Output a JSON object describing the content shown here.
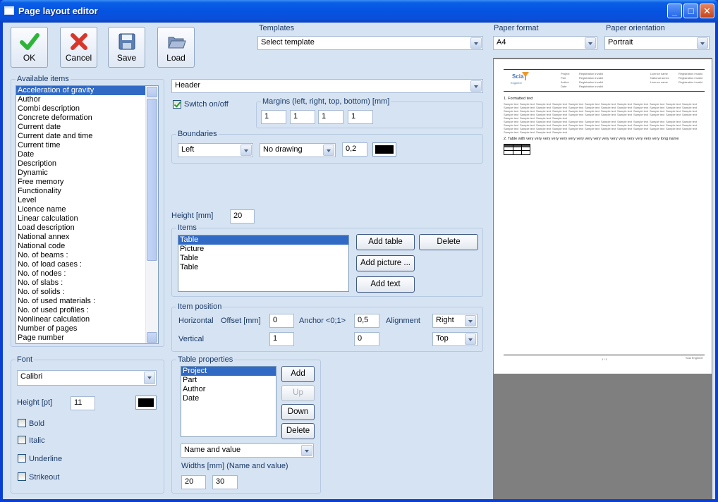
{
  "window": {
    "title": "Page layout editor",
    "minimize": "_",
    "maximize": "□",
    "close": "✕"
  },
  "toolbar": {
    "ok": "OK",
    "cancel": "Cancel",
    "save": "Save",
    "load": "Load"
  },
  "templates": {
    "label": "Templates",
    "value": "Select template"
  },
  "paper_format": {
    "label": "Paper format",
    "value": "A4"
  },
  "paper_orientation": {
    "label": "Paper orientation",
    "value": "Portrait"
  },
  "available_items": {
    "label": "Available items",
    "items": [
      "Acceleration of gravity",
      "Author",
      "Combi description",
      "Concrete deformation",
      "Current date",
      "Current date and time",
      "Current time",
      "Date",
      "Description",
      "Dynamic",
      "Free memory",
      "Functionality",
      "Level",
      "Licence name",
      "Linear calculation",
      "Load description",
      "National annex",
      "National code",
      "No. of beams :",
      "No. of load cases :",
      "No. of nodes :",
      "No. of slabs :",
      "No. of solids :",
      "No. of used materials :",
      "No. of used profiles :",
      "Nonlinear calculation",
      "Number of pages",
      "Page number"
    ],
    "selected_index": 0
  },
  "section": {
    "value": "Header",
    "switch_label": "Switch on/off",
    "switch_checked": true
  },
  "margins": {
    "label": "Margins (left, right, top, bottom) [mm]",
    "values": [
      "1",
      "1",
      "1",
      "1"
    ]
  },
  "boundaries": {
    "label": "Boundaries",
    "side": "Left",
    "drawing": "No drawing",
    "width": "0,2"
  },
  "height": {
    "label": "Height [mm]",
    "value": "20"
  },
  "items": {
    "label": "Items",
    "list": [
      "Table",
      "Picture",
      "Table",
      "Table"
    ],
    "selected_index": 0,
    "add_table": "Add table",
    "delete": "Delete",
    "add_picture": "Add picture ...",
    "add_text": "Add text"
  },
  "item_position": {
    "label": "Item position",
    "horizontal": "Horizontal",
    "vertical": "Vertical",
    "offset_label": "Offset [mm]",
    "anchor_label": "Anchor <0;1>",
    "alignment_label": "Alignment",
    "h_offset": "0",
    "h_anchor": "0,5",
    "h_alignment": "Right",
    "v_offset": "1",
    "v_anchor": "0",
    "v_alignment": "Top"
  },
  "table_properties": {
    "label": "Table properties",
    "list": [
      "Project",
      "Part",
      "Author",
      "Date"
    ],
    "selected_index": 0,
    "add": "Add",
    "up": "Up",
    "down": "Down",
    "delete": "Delete",
    "mode": "Name and value",
    "widths_label": "Widths [mm] (Name and value)",
    "width_name": "20",
    "width_value": "30"
  },
  "font": {
    "label": "Font",
    "family": "Calibri",
    "height_label": "Height [pt]",
    "height": "11",
    "bold": "Bold",
    "italic": "Italic",
    "underline": "Underline",
    "strikeout": "Strikeout"
  },
  "preview": {
    "logo_word": "Scia",
    "logo_sub": "Engineer",
    "header_left_labels": [
      "Project",
      "Part",
      "Author",
      "Date"
    ],
    "header_left_values": [
      "Registration invalid",
      "Registration invalid",
      "Registration invalid",
      "Registration invalid"
    ],
    "header_right_labels": [
      "Licence name",
      "National annex",
      "Licence name"
    ],
    "header_right_values": [
      "Registration invalid",
      "Registration invalid",
      "Registration invalid"
    ],
    "section1": "1. Formatted text",
    "sample_word": "Sample text",
    "section2": "2. Table with very very very very very very very very very very very very very very very very long name",
    "footer_page": "1 / 1",
    "footer_right": "Scia Engineer"
  },
  "colors": {
    "accent": "#316ac5",
    "client": "#d6e3f2",
    "title": "#0553e2"
  }
}
